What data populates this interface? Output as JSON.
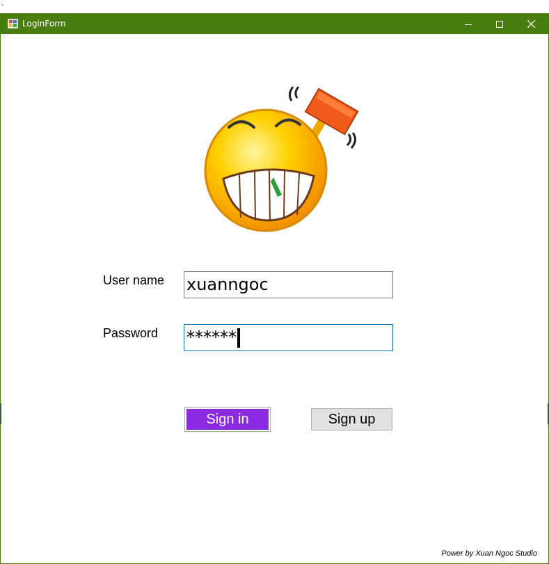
{
  "window": {
    "title": "LoginForm",
    "accent_color": "#4a7d0f",
    "controls": {
      "minimize": "minimize-icon",
      "maximize": "maximize-icon",
      "close": "close-icon"
    }
  },
  "mascot": {
    "icon": "laughing-smiley-hammer-icon"
  },
  "form": {
    "username_label": "User name",
    "username_value": "xuanngoc",
    "password_label": "Password",
    "password_value": "******"
  },
  "buttons": {
    "signin_label": "Sign in",
    "signin_color": "#8a2be2",
    "signup_label": "Sign up"
  },
  "footer": {
    "credit": "Power by Xuan Ngoc Studio"
  },
  "corner_mark": "."
}
